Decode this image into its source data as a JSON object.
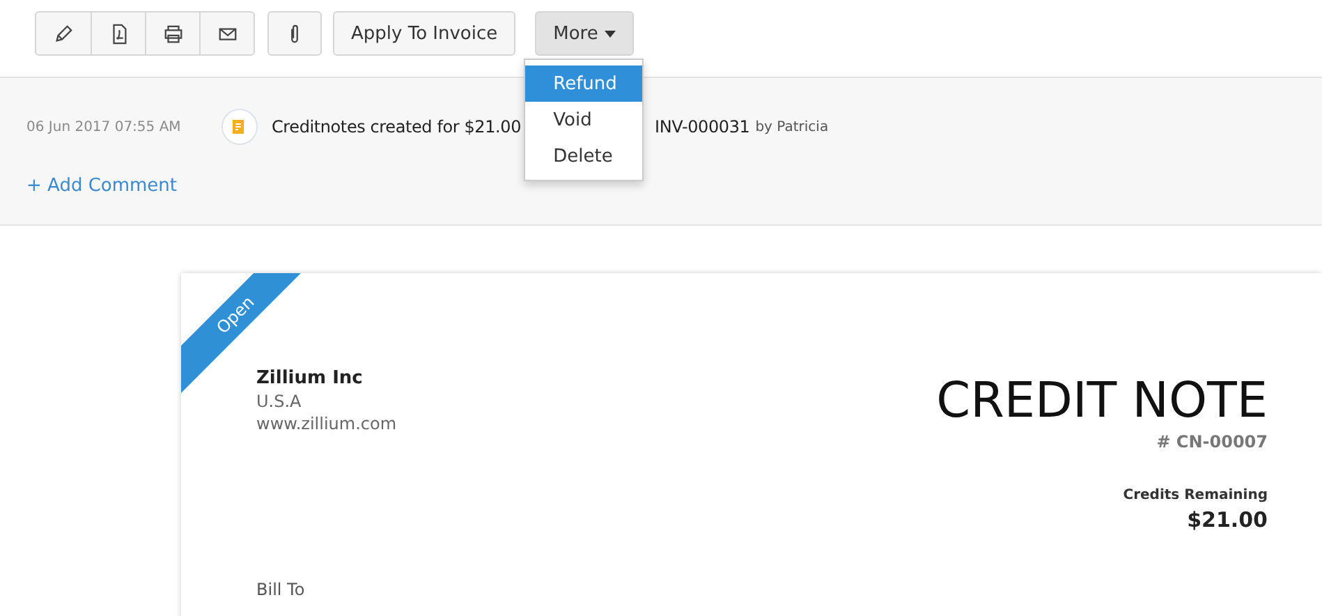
{
  "toolbar": {
    "icon_buttons": [
      {
        "kind": "edit"
      },
      {
        "kind": "pdf"
      },
      {
        "kind": "print"
      },
      {
        "kind": "email"
      }
    ],
    "attach": {
      "kind": "attach"
    },
    "apply_button": "Apply To Invoice",
    "more_button": "More",
    "more_open": true,
    "menu": [
      {
        "label": "Refund",
        "selected": true
      },
      {
        "label": "Void",
        "selected": false
      },
      {
        "label": "Delete",
        "selected": false
      }
    ]
  },
  "activity": {
    "time": "06 Jun 2017 07:55 AM",
    "text_start": "Creditnotes created for $21.00",
    "text_end": "INV-000031",
    "author": "by Patricia",
    "add_comment": "+ Add Comment"
  },
  "document": {
    "status": "Open",
    "company": "Zillium Inc",
    "country": "U.S.A",
    "website": "www.zillium.com",
    "title": "CREDIT NOTE",
    "number": "# CN-00007",
    "credits_label": "Credits Remaining",
    "credits_value": "$21.00",
    "bill_to": "Bill To"
  }
}
